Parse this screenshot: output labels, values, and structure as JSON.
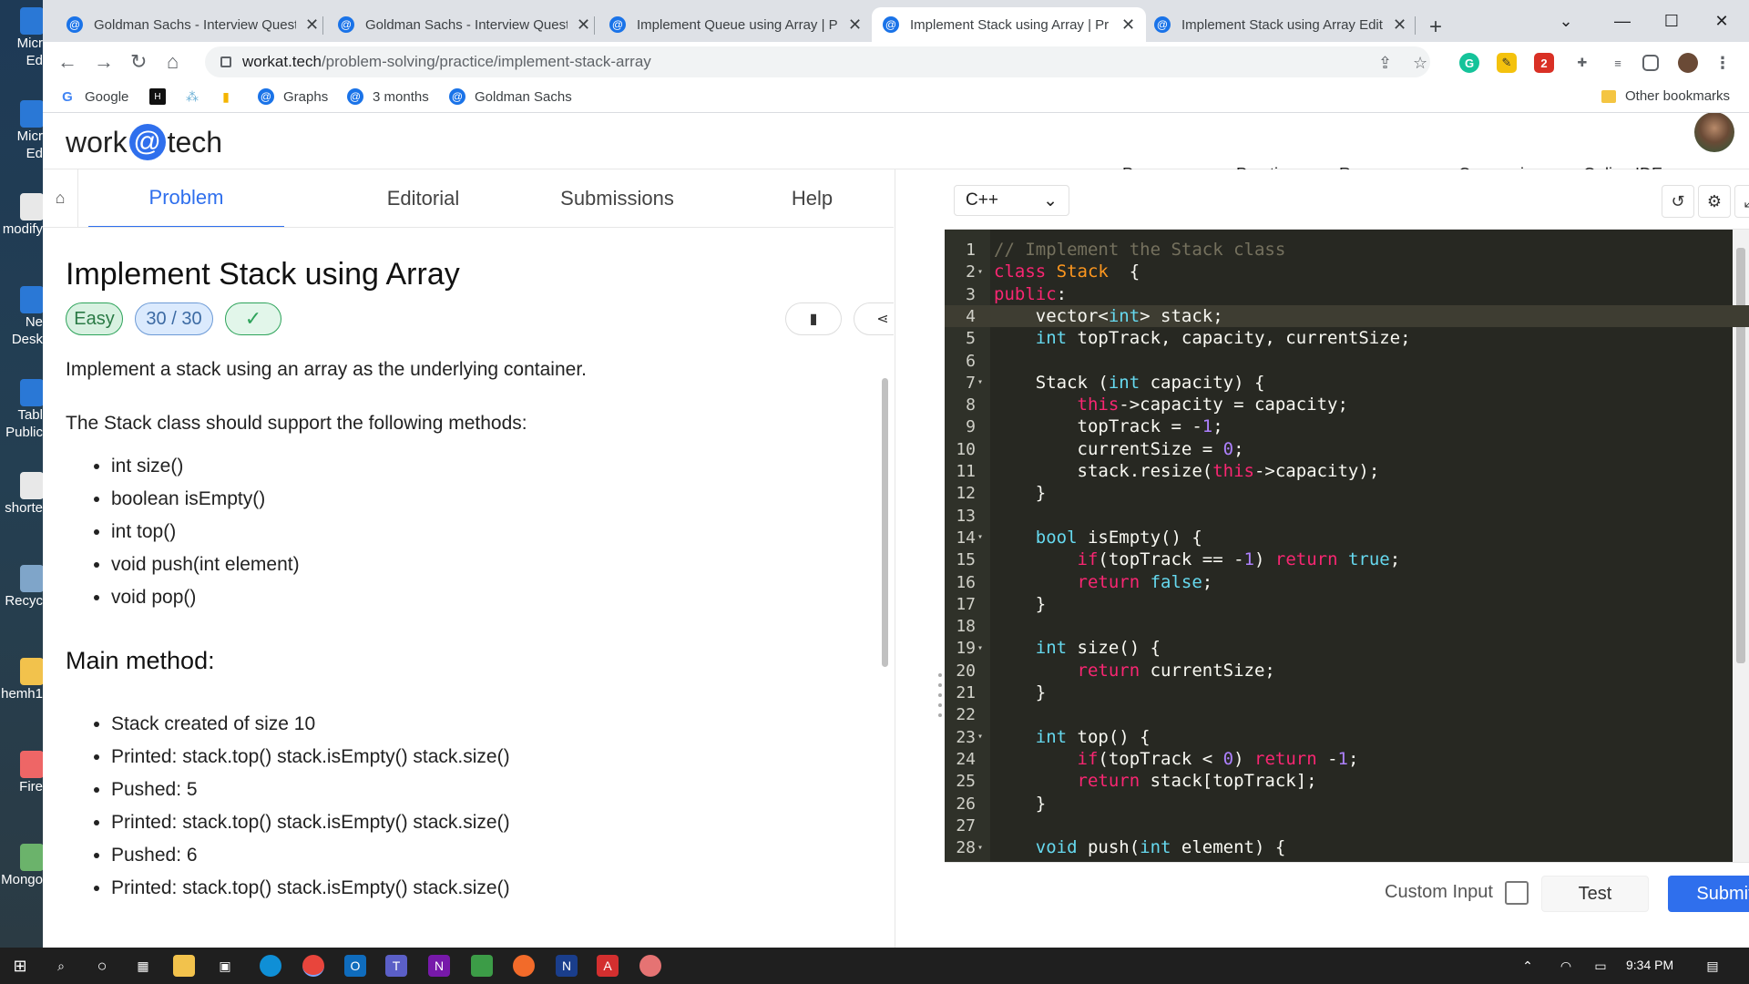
{
  "desktop": {
    "icons": [
      {
        "label": "Micr Ed",
        "color": "#2a78d6"
      },
      {
        "label": "Micr Ed",
        "color": "#2a78d6"
      },
      {
        "label": "modify",
        "color": "#e8e8e8"
      },
      {
        "label": "Ne Desk",
        "color": "#2a78d6"
      },
      {
        "label": "Tabl Public",
        "color": "#2a78d6"
      },
      {
        "label": "shorte",
        "color": "#e8e8e8"
      },
      {
        "label": "Recyc",
        "color": "#7fa5c9"
      },
      {
        "label": "hemh1",
        "color": "#f2c24c"
      },
      {
        "label": "Fire",
        "color": "#e66"
      },
      {
        "label": "Mongo",
        "color": "#6bb36b"
      }
    ]
  },
  "browser": {
    "tabs": [
      {
        "title": "Goldman Sachs - Interview Quest",
        "icon": "@"
      },
      {
        "title": "Goldman Sachs - Interview Quest",
        "icon": "@"
      },
      {
        "title": "Implement Queue using Array | P",
        "icon": "@"
      },
      {
        "title": "Implement Stack using Array | Pr",
        "icon": "@"
      },
      {
        "title": "Implement Stack using Array Edit",
        "icon": "@"
      }
    ],
    "close_glyph": "✕",
    "new_tab_glyph": "+",
    "url_host": "workat.tech",
    "url_path": "/problem-solving/practice/implement-stack-array",
    "bookmarks": [
      {
        "label": "Google",
        "icon": "G"
      },
      {
        "label": "Graphs",
        "icon": "@"
      },
      {
        "label": "3 months",
        "icon": "@"
      },
      {
        "label": "Goldman Sachs",
        "icon": "@"
      }
    ],
    "other_bookmarks": "Other bookmarks",
    "extension_badge": "2"
  },
  "site": {
    "logo_left": "work",
    "logo_at": "@",
    "logo_right": "tech",
    "menu": [
      "Programs ▾",
      "Practice ▾",
      "Resources ▾",
      "Companies ▾",
      "Online IDE"
    ]
  },
  "problem": {
    "tabs": [
      "Problem",
      "Editorial",
      "Submissions",
      "Help"
    ],
    "title": "Implement Stack using Array",
    "difficulty": "Easy",
    "score": "30 / 30",
    "check": "✓",
    "intro": "Implement a stack using an array as the underlying container.",
    "methods_intro": "The Stack class should support the following methods:",
    "methods": [
      "int size()",
      "boolean isEmpty()",
      "int top()",
      "void push(int element)",
      "void pop()"
    ],
    "main_heading": "Main method:",
    "main_steps": [
      "Stack created of size 10",
      "Printed: stack.top() stack.isEmpty() stack.size()",
      "Pushed: 5",
      "Printed: stack.top() stack.isEmpty() stack.size()",
      "Pushed: 6",
      "Printed: stack.top() stack.isEmpty() stack.size()"
    ]
  },
  "editor": {
    "language": "C++",
    "lang_caret": "⌄",
    "custom_input_label": "Custom Input",
    "test_label": "Test",
    "submit_label": "Submit",
    "highlight_line": 4,
    "fold_lines": [
      2,
      7,
      14,
      19,
      23,
      28
    ]
  },
  "taskbar": {
    "time": "9:34 PM"
  }
}
